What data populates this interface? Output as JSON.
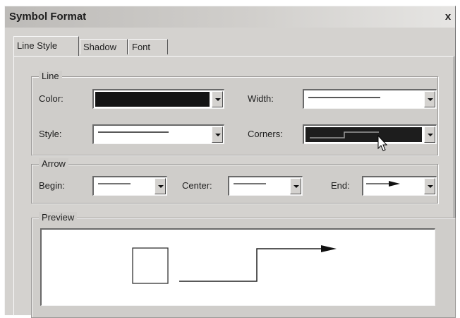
{
  "window": {
    "title": "Symbol Format",
    "close_label": "x"
  },
  "tabs": [
    {
      "label": "Line Style",
      "active": true
    },
    {
      "label": "Shadow",
      "active": false
    },
    {
      "label": "Font",
      "active": false
    }
  ],
  "line_group": {
    "legend": "Line",
    "color_label": "Color:",
    "color_value": "#141414",
    "width_label": "Width:",
    "style_label": "Style:",
    "corners_label": "Corners:"
  },
  "arrow_group": {
    "legend": "Arrow",
    "begin_label": "Begin:",
    "center_label": "Center:",
    "end_label": "End:"
  },
  "preview_group": {
    "legend": "Preview"
  },
  "icons": {
    "dropdown": "chevron-down-icon",
    "pointer": "mouse-pointer-icon"
  }
}
